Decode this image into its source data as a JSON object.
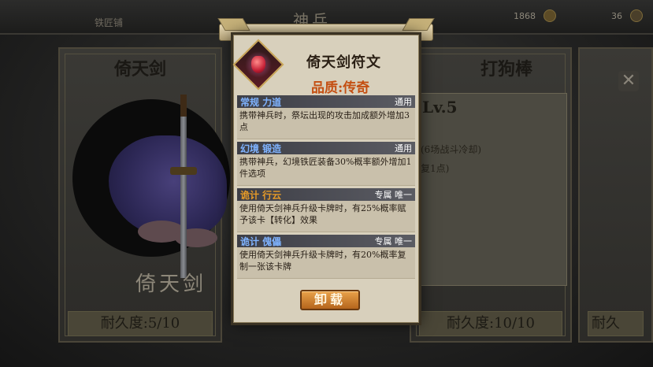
{
  "top_bar": {
    "left_text": "铁匠铺",
    "title": "神兵",
    "stat1": "1868",
    "stat2": "36"
  },
  "background": {
    "left_card_title": "倚天剑",
    "left_card_name": "倚天剑",
    "left_card_durability": "耐久度:5/10",
    "right_card_title": "打狗棒",
    "right_level": "Lv.5",
    "right_text1": "(6场战斗冷却)",
    "right_text2": "复1点)",
    "right_card_durability": "耐久度:10/10",
    "far_right_durability": "耐久",
    "close_glyph": "✕"
  },
  "modal": {
    "title": "倚天剑符文",
    "quality": "品质:传奇",
    "effects": [
      {
        "name": "常规 力道",
        "tag": "通用",
        "desc": "携带神兵时，祭坛出现的攻击加成额外增加3点",
        "color": "#7fb3ff"
      },
      {
        "name": "幻境 锻造",
        "tag": "通用",
        "desc": "携带神兵，幻境铁匠装备30%概率额外增加1件选项",
        "color": "#7fb3ff"
      },
      {
        "name": "诡计 行云",
        "tag": "专属 唯一",
        "desc": "使用倚天剑神兵升级卡牌时，有25%概率赋予该卡【转化】效果",
        "color": "#e59a28"
      },
      {
        "name": "诡计 傀儡",
        "tag": "专属 唯一",
        "desc": "使用倚天剑神兵升级卡牌时，有20%概率复制一张该卡牌",
        "color": "#7fb3ff"
      }
    ],
    "unload_button": "卸载"
  },
  "colors": {
    "quality_legendary": "#c44f12",
    "button_orange": "#d98a34"
  }
}
